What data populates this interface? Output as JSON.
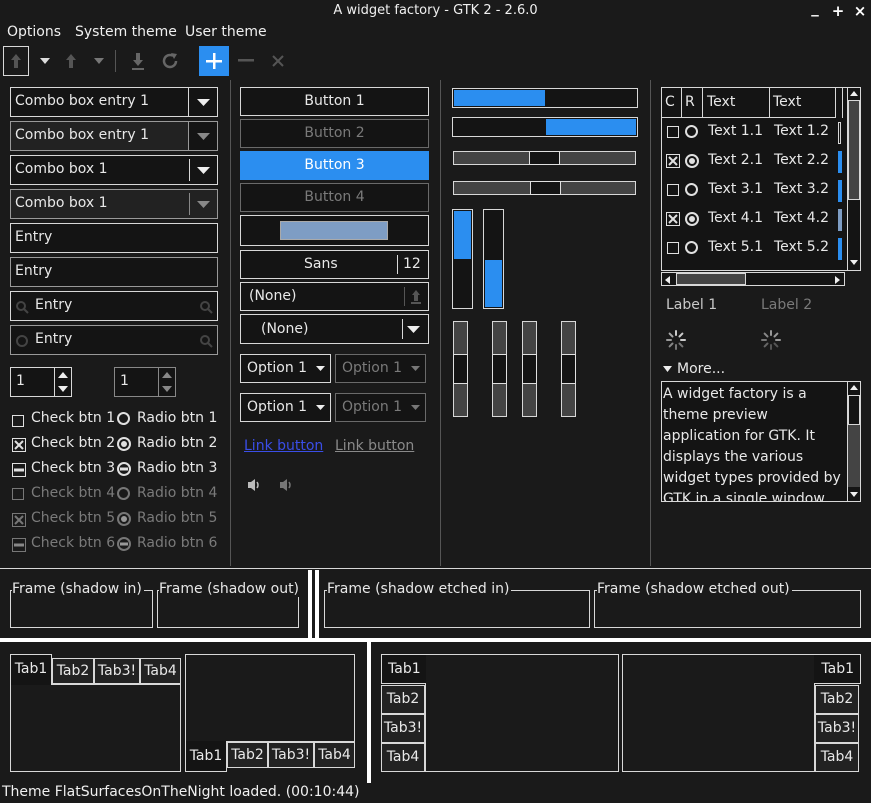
{
  "window": {
    "title": "A widget factory - GTK 2 - 2.6.0",
    "minimize": "_",
    "maximize": "+",
    "close": "×"
  },
  "menubar": [
    "Options",
    "System theme",
    "User theme"
  ],
  "toolbar_icons": [
    "up-arrow-icon",
    "chevron-down-icon",
    "up-arrow-icon",
    "chevron-down-icon",
    "download-icon",
    "refresh-icon",
    "add-icon",
    "remove-icon",
    "close-icon"
  ],
  "col1": {
    "combo_entry_1": "Combo box entry 1",
    "combo_entry_2": "Combo box entry 1",
    "combo_1": "Combo box 1",
    "combo_2": "Combo box 1",
    "entry_1": "Entry",
    "entry_2": "Entry",
    "entry_3": "Entry",
    "entry_4": "Entry",
    "spin_1": "1",
    "spin_2": "1",
    "checks": [
      "Check btn 1",
      "Check btn 2",
      "Check btn 3",
      "Check btn 4",
      "Check btn 5",
      "Check btn 6"
    ],
    "radios": [
      "Radio btn 1",
      "Radio btn 2",
      "Radio btn 3",
      "Radio btn 4",
      "Radio btn 5",
      "Radio btn 6"
    ]
  },
  "col2": {
    "buttons": [
      "Button 1",
      "Button 2",
      "Button 3",
      "Button 4"
    ],
    "font_name": "Sans",
    "font_size": "12",
    "file_chooser": "(None)",
    "combo_none": "(None)",
    "option_1": "Option 1",
    "option_2": "Option 1",
    "option_3": "Option 1",
    "option_4": "Option 1",
    "link_1": "Link button",
    "link_2": "Link button"
  },
  "progress": {
    "h1": 0.5,
    "h2": 0.5,
    "v1": 0.5,
    "v2": 0.5
  },
  "scales": {
    "h1": 0.5,
    "h2": 0.5,
    "v": [
      0.5,
      0.5,
      0.5,
      0.5
    ]
  },
  "tree": {
    "headers": [
      "C",
      "R",
      "Text",
      "Text"
    ],
    "rows": [
      {
        "check": false,
        "radio": false,
        "t1": "Text 1.1",
        "t2": "Text 1.2"
      },
      {
        "check": true,
        "radio": true,
        "t1": "Text 2.1",
        "t2": "Text 2.2"
      },
      {
        "check": false,
        "radio": false,
        "t1": "Text 3.1",
        "t2": "Text 3.2"
      },
      {
        "check": true,
        "radio": true,
        "t1": "Text 4.1",
        "t2": "Text 4.2"
      },
      {
        "check": false,
        "radio": false,
        "t1": "Text 5.1",
        "t2": "Text 5.2"
      }
    ]
  },
  "labels": {
    "label_1": "Label 1",
    "label_2": "Label 2",
    "more": "More..."
  },
  "textview": "A widget factory is a theme preview application for GTK. It displays the various widget types provided by GTK in a single window",
  "frames": [
    "Frame (shadow in)",
    "Frame (shadow out)",
    "Frame (shadow etched in)",
    "Frame (shadow etched out)"
  ],
  "tabs": [
    "Tab1",
    "Tab2",
    "Tab3!",
    "Tab4"
  ],
  "status": "Theme FlatSurfacesOnTheNight loaded.  (00:10:44)",
  "colors": {
    "accent": "#2b8ef0",
    "background": "#1a1a1a",
    "border": "#d8d8d8"
  }
}
